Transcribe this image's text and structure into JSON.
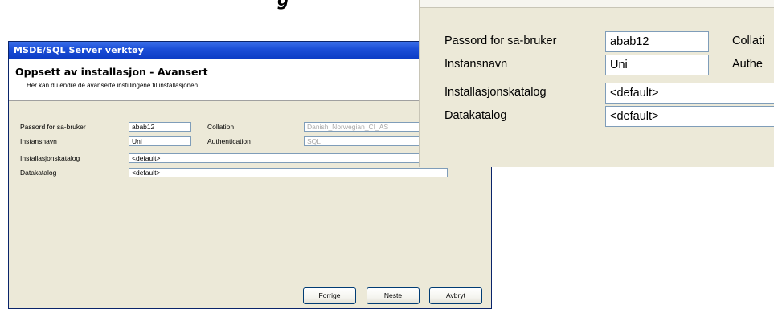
{
  "caption_fragment": "g",
  "dialog": {
    "title": "MSDE/SQL Server verktøy",
    "header_title": "Oppsett av installasjon - Avansert",
    "header_subtitle": "Her kan du endre de avanserte instillingene til installasjonen",
    "fields": {
      "sa_password": {
        "label": "Passord for sa-bruker",
        "value": "abab12"
      },
      "instance_name": {
        "label": "Instansnavn",
        "value": "Uni"
      },
      "install_dir": {
        "label": "Installasjonskatalog",
        "value": "<default>"
      },
      "data_dir": {
        "label": "Datakatalog",
        "value": "<default>"
      },
      "collation": {
        "label": "Collation",
        "value": "Danish_Norwegian_CI_AS"
      },
      "authentication": {
        "label": "Authentication",
        "value": "SQL"
      }
    },
    "buttons": {
      "back": "Forrige",
      "next": "Neste",
      "cancel": "Avbryt"
    }
  },
  "zoom": {
    "sa_password": {
      "label": "Passord for sa-bruker",
      "value": "abab12"
    },
    "instance_name": {
      "label": "Instansnavn",
      "value": "Uni"
    },
    "install_dir": {
      "label": "Installasjonskatalog",
      "value": "<default>"
    },
    "data_dir": {
      "label": "Datakatalog",
      "value": "<default>"
    },
    "collation_label_partial": "Collati",
    "authentication_label_partial": "Authe"
  },
  "colors": {
    "titlebar": "#1c4fd8",
    "dialog_bg": "#ece9d8",
    "field_border": "#7f9db9",
    "disabled_text": "#a8a8a8"
  }
}
